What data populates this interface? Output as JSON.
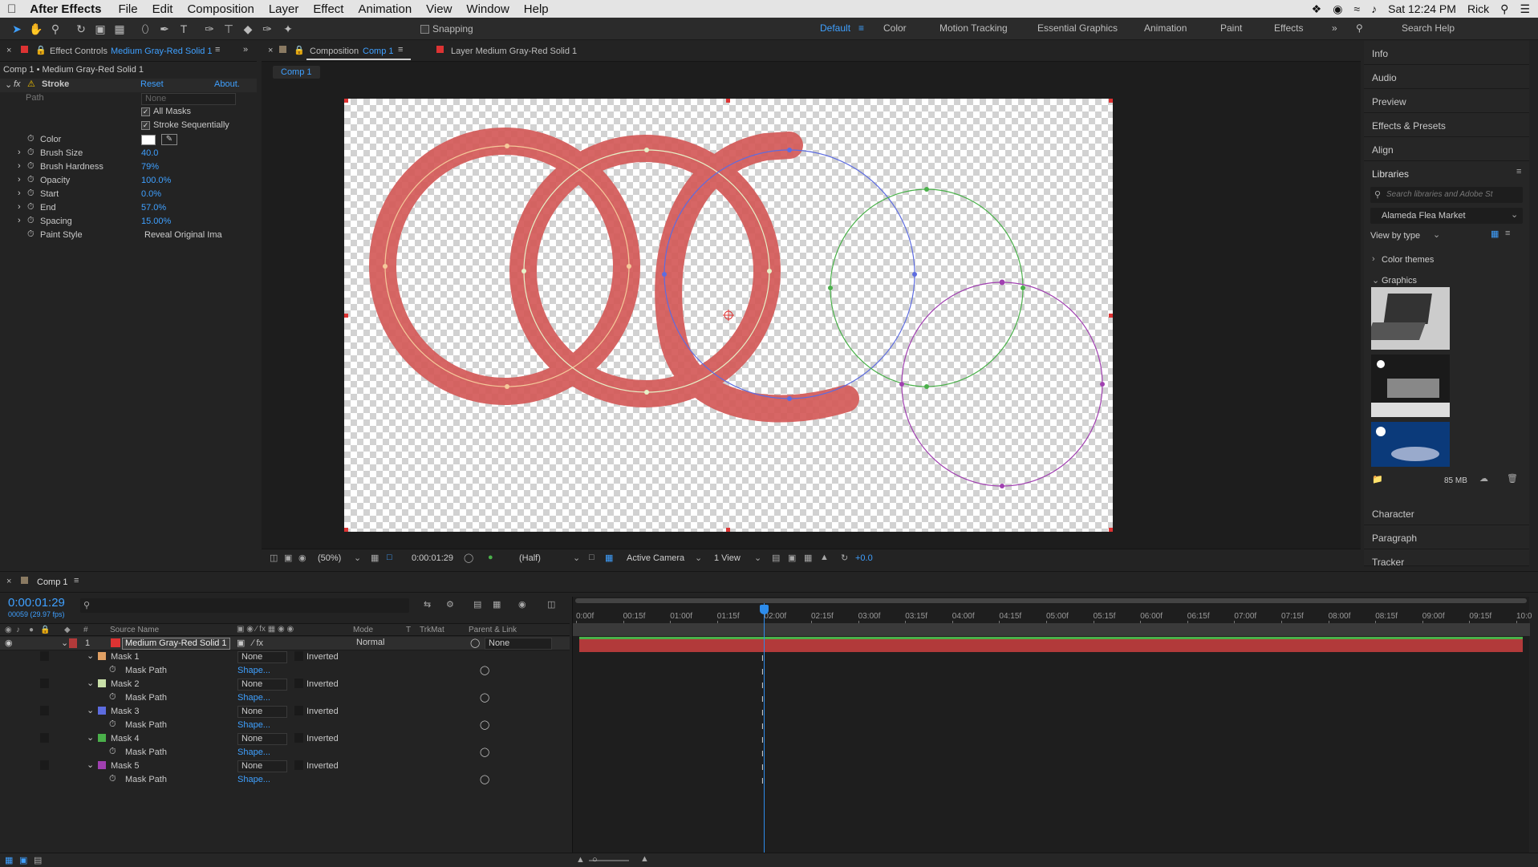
{
  "menubar": {
    "app": "After Effects",
    "items": [
      "File",
      "Edit",
      "Composition",
      "Layer",
      "Effect",
      "Animation",
      "View",
      "Window",
      "Help"
    ],
    "time": "Sat 12:24 PM",
    "user": "Rick"
  },
  "toolbar": {
    "snapping": "Snapping",
    "workspaces": [
      "Default",
      "Color",
      "Motion Tracking",
      "Essential Graphics",
      "Animation",
      "Paint",
      "Effects"
    ],
    "search": "Search Help"
  },
  "effect_controls": {
    "tab": "Effect Controls",
    "tab_layer": "Medium Gray-Red Solid 1",
    "path_title": "Comp 1 • Medium Gray-Red Solid 1",
    "effect": "Stroke",
    "reset": "Reset",
    "about": "About.",
    "path_label": "Path",
    "path_value": "None",
    "all_masks": "All Masks",
    "stroke_seq": "Stroke Sequentially",
    "color_label": "Color",
    "props": [
      {
        "label": "Brush Size",
        "value": "40.0"
      },
      {
        "label": "Brush Hardness",
        "value": "79%"
      },
      {
        "label": "Opacity",
        "value": "100.0%"
      },
      {
        "label": "Start",
        "value": "0.0%"
      },
      {
        "label": "End",
        "value": "57.0%"
      },
      {
        "label": "Spacing",
        "value": "15.00%"
      }
    ],
    "paint_style_label": "Paint Style",
    "paint_style_value": "Reveal Original Ima"
  },
  "composition": {
    "tab": "Composition",
    "tab_comp": "Comp 1",
    "layer_tab": "Layer Medium Gray-Red Solid 1",
    "breadcrumb": "Comp 1",
    "zoom": "(50%)",
    "timecode": "0:00:01:29",
    "resolution": "(Half)",
    "camera": "Active Camera",
    "views": "1 View",
    "exposure": "+0.0"
  },
  "right_panel": {
    "items": [
      "Info",
      "Audio",
      "Preview",
      "Effects & Presets",
      "Align"
    ],
    "libraries": "Libraries",
    "lib_search": "Search libraries and Adobe St",
    "library": "Alameda Flea Market",
    "view_by": "View by type",
    "color_themes": "Color themes",
    "graphics": "Graphics",
    "size": "85 MB",
    "bottom_items": [
      "Character",
      "Paragraph",
      "Tracker"
    ]
  },
  "timeline": {
    "tab": "Comp 1",
    "timecode": "0:00:01:29",
    "frames": "00059 (29.97 fps)",
    "headers": {
      "num": "#",
      "source": "Source Name",
      "mode": "Mode",
      "t": "T",
      "trkmat": "TrkMat",
      "parent": "Parent & Link"
    },
    "layer": {
      "num": "1",
      "name": "Medium Gray-Red Solid 1",
      "mode": "Normal",
      "parent": "None"
    },
    "masks": [
      {
        "name": "Mask 1",
        "mode": "None",
        "inv": "Inverted",
        "path": "Mask Path",
        "shape": "Shape...",
        "color": "#e0a064"
      },
      {
        "name": "Mask 2",
        "mode": "None",
        "inv": "Inverted",
        "path": "Mask Path",
        "shape": "Shape...",
        "color": "#c9e0a8"
      },
      {
        "name": "Mask 3",
        "mode": "None",
        "inv": "Inverted",
        "path": "Mask Path",
        "shape": "Shape...",
        "color": "#5d6ce0"
      },
      {
        "name": "Mask 4",
        "mode": "None",
        "inv": "Inverted",
        "path": "Mask Path",
        "shape": "Shape...",
        "color": "#4ab04a"
      },
      {
        "name": "Mask 5",
        "mode": "None",
        "inv": "Inverted",
        "path": "Mask Path",
        "shape": "Shape...",
        "color": "#a040b0"
      }
    ],
    "ticks": [
      "0:00f",
      "00:15f",
      "01:00f",
      "01:15f",
      "02:00f",
      "02:15f",
      "03:00f",
      "03:15f",
      "04:00f",
      "04:15f",
      "05:00f",
      "05:15f",
      "06:00f",
      "06:15f",
      "07:00f",
      "07:15f",
      "08:00f",
      "08:15f",
      "09:00f",
      "09:15f",
      "10:0"
    ]
  },
  "colors": {
    "accent": "#2d8ceb",
    "stroke": "#d9534f",
    "layer_bar": "#b23a3a"
  }
}
